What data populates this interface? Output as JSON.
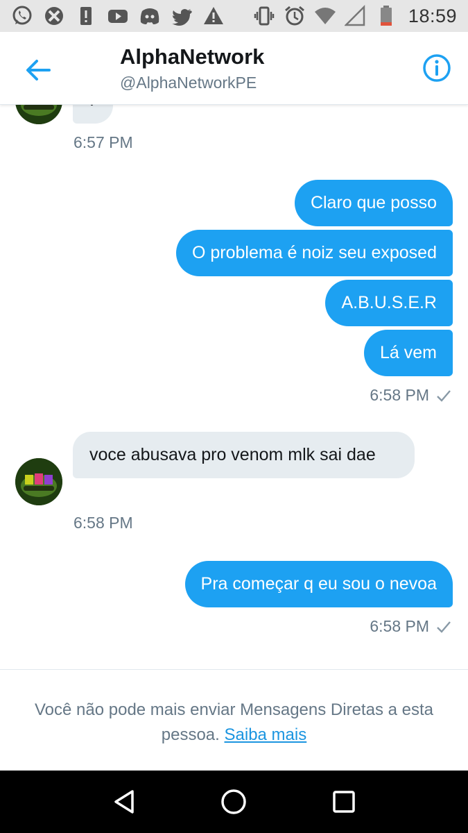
{
  "status_bar": {
    "time": "18:59",
    "left_icons": [
      "whatsapp-icon",
      "xbox-icon",
      "alert-icon",
      "youtube-icon",
      "discord-icon",
      "twitter-icon",
      "warning-icon"
    ],
    "right_icons": [
      "vibrate-icon",
      "alarm-icon",
      "wifi-icon",
      "signal-icon",
      "battery-icon"
    ]
  },
  "header": {
    "title": "AlphaNetwork",
    "handle": "@AlphaNetworkPE",
    "back_icon": "arrow-left-icon",
    "info_icon": "info-icon"
  },
  "conversation": {
    "partial_bubble_text": ".",
    "messages": [
      {
        "id": "m1",
        "direction": "in",
        "text": ".",
        "time": "6:57 PM"
      },
      {
        "id": "m2",
        "direction": "out",
        "text": "Claro que posso"
      },
      {
        "id": "m3",
        "direction": "out",
        "text": "O problema é noiz seu exposed"
      },
      {
        "id": "m4",
        "direction": "out",
        "text": "A.B.U.S.E.R"
      },
      {
        "id": "m5",
        "direction": "out",
        "text": "Lá vem",
        "time": "6:58 PM",
        "read": true
      },
      {
        "id": "m6",
        "direction": "in",
        "text": "voce abusava pro venom mlk sai dae",
        "time": "6:58 PM"
      },
      {
        "id": "m7",
        "direction": "out",
        "text": "Pra começar q eu sou o nevoa",
        "time": "6:58 PM",
        "read": true
      }
    ]
  },
  "notice": {
    "text": "Você não pode mais enviar Mensagens Diretas a esta pessoa.",
    "link_text": "Saiba mais"
  },
  "nav_bar": {
    "icons": [
      "back-triangle-icon",
      "home-circle-icon",
      "recents-square-icon"
    ]
  },
  "colors": {
    "accent": "#1da1f2",
    "incoming_bubble": "#e6ecf0",
    "secondary_text": "#657786",
    "link": "#1b95e0",
    "status_bar": "#e6e6e6",
    "nav_bar": "#000000"
  }
}
